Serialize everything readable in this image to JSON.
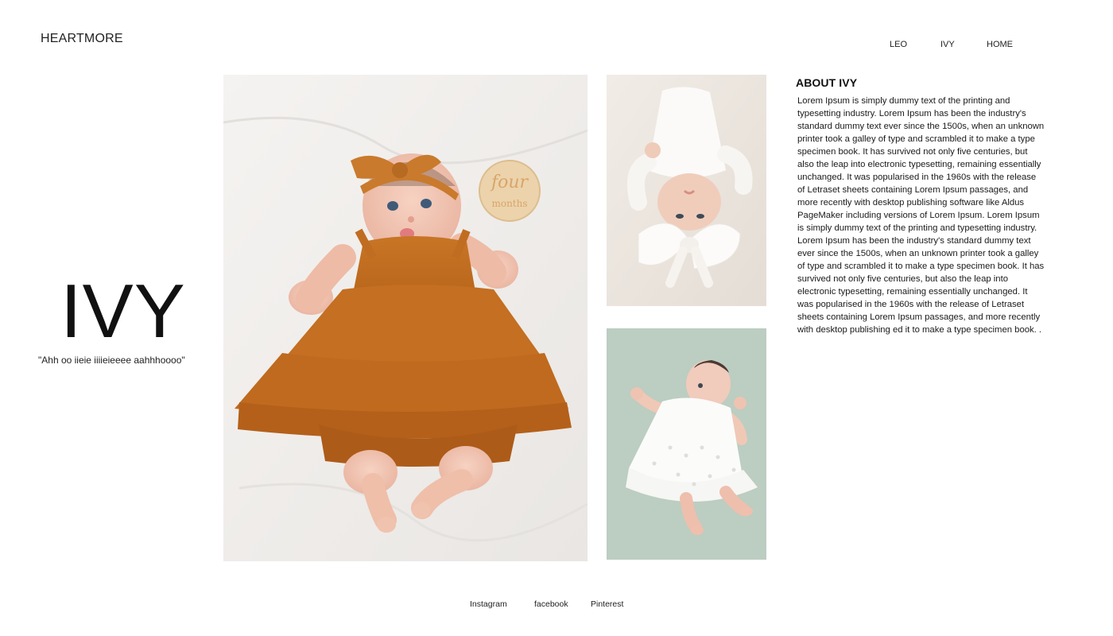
{
  "header": {
    "brand": "HEARTMORE",
    "nav": [
      {
        "label": "LEO"
      },
      {
        "label": "IVY"
      },
      {
        "label": "HOME"
      }
    ]
  },
  "hero": {
    "name": "IVY",
    "quote": "\"Ahh oo iieie iiiieieeee aahhhoooo\""
  },
  "gallery": {
    "main_photo_badge_line1": "four",
    "main_photo_badge_line2": "months"
  },
  "about": {
    "title": "ABOUT IVY",
    "body": "Lorem Ipsum is simply dummy text of the printing and typesetting industry. Lorem Ipsum has been the industry's standard dummy text ever since the 1500s, when an unknown printer took a galley of type and scrambled it to make a type specimen book. It has survived not only five centuries, but also the leap into electronic typesetting, remaining essentially unchanged. It was popularised in the 1960s with the release of Letraset sheets containing Lorem Ipsum passages, and more recently with desktop publishing software like Aldus PageMaker including versions of Lorem Ipsum. Lorem Ipsum is simply dummy text of the printing and typesetting industry. Lorem Ipsum has been the industry's standard dummy text ever since the 1500s, when an unknown printer took a galley of type and scrambled it to make a type specimen book. It has survived not only five centuries, but also the leap into electronic typesetting, remaining essentially unchanged. It was popularised in the 1960s with the release of Letraset sheets containing Lorem Ipsum passages, and more recently with desktop publishing ed it to make a type specimen book. ."
  },
  "footer": {
    "links": [
      {
        "label": "Instagram"
      },
      {
        "label": "facebook"
      },
      {
        "label": "Pinterest"
      }
    ]
  },
  "colors": {
    "dress_orange": "#c9711f",
    "headband_orange": "#c97a2c",
    "sheet_white": "#f2f0ee",
    "sage_background": "#bccdc1",
    "badge_wood": "#e9cfa6"
  }
}
